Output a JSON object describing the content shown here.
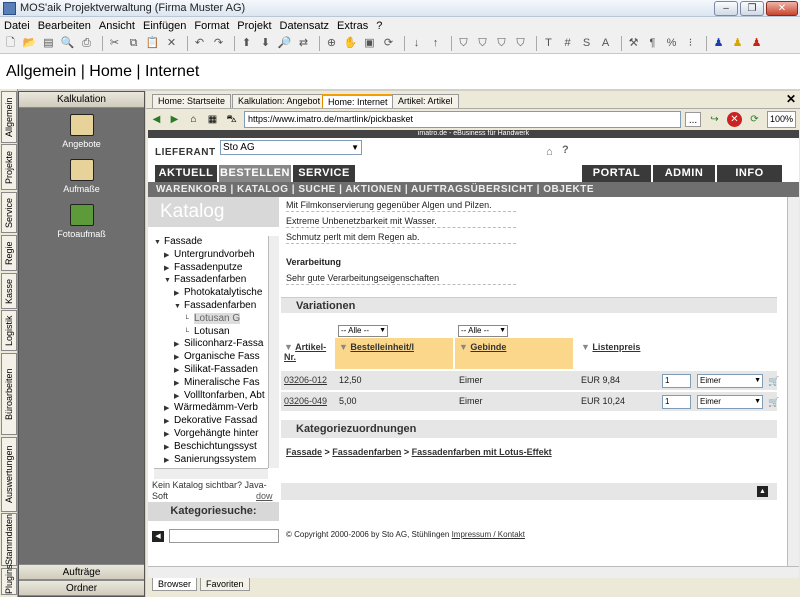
{
  "window": {
    "title": "MOS'aik Projektverwaltung (Firma Muster AG)"
  },
  "menu": [
    "Datei",
    "Bearbeiten",
    "Ansicht",
    "Einfügen",
    "Format",
    "Projekt",
    "Datensatz",
    "Extras",
    "?"
  ],
  "page_title": "Allgemein | Home | Internet",
  "vtabs": [
    "Allgemein",
    "Projekte",
    "Service",
    "Regie",
    "Kasse",
    "Logistik",
    "Büroarbeiten",
    "Auswertungen",
    "Stammdaten",
    "Plugins"
  ],
  "left_panel": {
    "header": "Kalkulation",
    "items": [
      "Angebote",
      "Aufmaße",
      "Fotoaufmaß"
    ],
    "bottom": [
      "Aufträge",
      "Ordner"
    ]
  },
  "browser": {
    "tabs": [
      "Home: Startseite",
      "Kalkulation: Angebot",
      "Home: Internet",
      "Artikel: Artikel"
    ],
    "url": "https://www.imatro.de/martlink/pickbasket",
    "zoom": "100%",
    "url_btn": "...",
    "bottom_tabs": [
      "Browser",
      "Favoriten"
    ]
  },
  "web": {
    "tagline": "imatro.de - eBusiness für Handwerk",
    "lieferant_label": "LIEFERANT",
    "lieferant_value": "Sto AG",
    "nav_left": [
      "AKTUELL",
      "BESTELLEN",
      "SERVICE"
    ],
    "nav_right": [
      "PORTAL",
      "ADMIN",
      "INFO"
    ],
    "nav2": "WARENKORB | KATALOG | SUCHE | AKTIONEN | AUFTRAGSÜBERSICHT | OBJEKTE",
    "katalog_title": "Katalog",
    "tree": [
      {
        "label": "Fassade",
        "lvl": 0,
        "open": true
      },
      {
        "label": "Untergrundvorbeh",
        "lvl": 1
      },
      {
        "label": "Fassadenputze",
        "lvl": 1
      },
      {
        "label": "Fassadenfarben",
        "lvl": 1,
        "open": true
      },
      {
        "label": "Photokatalytische",
        "lvl": 2
      },
      {
        "label": "Fassadenfarben",
        "lvl": 2,
        "open": true
      },
      {
        "label": "Lotusan G",
        "lvl": 3,
        "selected": true
      },
      {
        "label": "Lotusan",
        "lvl": 3
      },
      {
        "label": "Siliconharz-Fassa",
        "lvl": 2
      },
      {
        "label": "Organische Fass",
        "lvl": 2
      },
      {
        "label": "Silikat-Fassaden",
        "lvl": 2
      },
      {
        "label": "Mineralische Fas",
        "lvl": 2
      },
      {
        "label": "Vollltonfarben, Abt",
        "lvl": 2
      },
      {
        "label": "Wärmedämm-Verb",
        "lvl": 1
      },
      {
        "label": "Dekorative Fassad",
        "lvl": 1
      },
      {
        "label": "Vorgehängte hinter",
        "lvl": 1
      },
      {
        "label": "Beschichtungssyst",
        "lvl": 1
      },
      {
        "label": "Sanierungssystem",
        "lvl": 1
      }
    ],
    "katalog_note": "Kein Katalog sichtbar? Java-Soft",
    "katalog_dl": "dow",
    "kategoriesuche": "Kategoriesuche:",
    "desc_lines": [
      "Mit Filmkonservierung gegenüber Algen und Pilzen.",
      "Extreme Unbenetzbarkeit mit Wasser.",
      "Schmutz perlt mit dem Regen ab."
    ],
    "verarbeitung_title": "Verarbeitung",
    "verarbeitung_text": "Sehr gute Verarbeitungseigenschaften",
    "variationen": "Variationen",
    "filter_all": "-- Alle --",
    "cols": [
      "Artikel-Nr.",
      "Bestelleinheit/l",
      "Gebinde",
      "Listenpreis"
    ],
    "rows": [
      {
        "nr": "03206-012",
        "einheit": "12,50",
        "gebinde": "Eimer",
        "preis": "EUR 9,84",
        "qty": "1",
        "unit": "Eimer"
      },
      {
        "nr": "03206-049",
        "einheit": "5,00",
        "gebinde": "Eimer",
        "preis": "EUR 10,24",
        "qty": "1",
        "unit": "Eimer"
      }
    ],
    "kategorie_title": "Kategoriezuordnungen",
    "breadcrumb": [
      "Fassade",
      "Fassadenfarben",
      "Fassadenfarben mit Lotus-Effekt"
    ],
    "copyright": "© Copyright 2000-2006 by Sto AG, Stühlingen",
    "impressum": "Impressum / Kontakt"
  }
}
